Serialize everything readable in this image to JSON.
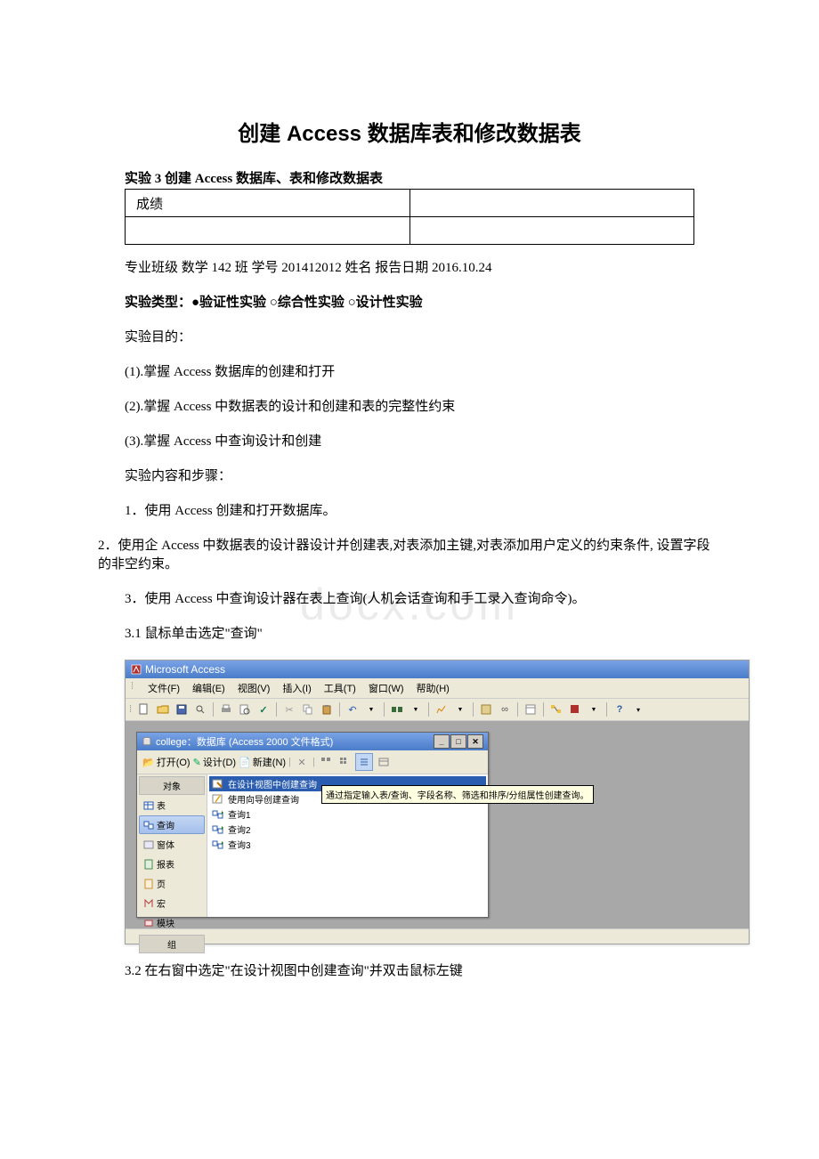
{
  "title": "创建 Access 数据库表和修改数据表",
  "subtitle": "实验 3 创建 Access 数据库、表和修改数据表",
  "score_row1_left": "成绩",
  "score_row1_right": "",
  "score_row2_left": "",
  "score_row2_right": "",
  "student_info": "专业班级 数学 142 班  学号 201412012 姓名   报告日期 2016.10.24",
  "exp_type": "实验类型：●验证性实验 ○综合性实验 ○设计性实验",
  "purpose_label": "实验目的：",
  "purpose_1": "(1).掌握 Access 数据库的创建和打开",
  "purpose_2": "(2).掌握 Access 中数据表的设计和创建和表的完整性约束",
  "purpose_3": "(3).掌握 Access 中查询设计和创建",
  "content_label": "实验内容和步骤：",
  "step1": "1．使用 Access 创建和打开数据库。",
  "step2": "2．使用企 Access 中数据表的设计器设计并创建表,对表添加主键,对表添加用户定义的约束条件, 设置字段的非空约束。",
  "step3": "3．使用 Access 中查询设计器在表上查询(人机会话查询和手工录入查询命令)。",
  "step31": "3.1 鼠标单击选定\"查询\"",
  "step32": "3.2 在右窗中选定\"在设计视图中创建查询\"并双击鼠标左键",
  "watermark": "docx.com",
  "screenshot": {
    "app_title": "Microsoft Access",
    "menu": {
      "file": "文件(F)",
      "edit": "编辑(E)",
      "view": "视图(V)",
      "insert": "插入(I)",
      "tools": "工具(T)",
      "window": "窗口(W)",
      "help": "帮助(H)"
    },
    "db": {
      "title": "college：数据库 (Access 2000 文件格式)",
      "open": "打开(O)",
      "design": "设计(D)",
      "new": "新建(N)",
      "objects_header": "对象",
      "groups_header": "组",
      "objects": {
        "tables": "表",
        "queries": "查询",
        "forms": "窗体",
        "reports": "报表",
        "pages": "页",
        "macros": "宏",
        "modules": "模块"
      },
      "list": {
        "create_design": "在设计视图中创建查询",
        "create_wizard": "使用向导创建查询",
        "q1": "查询1",
        "q2": "查询2",
        "q3": "查询3"
      },
      "tooltip": "通过指定输入表/查询、字段名称、筛选和排序/分组属性创建查询。"
    }
  }
}
